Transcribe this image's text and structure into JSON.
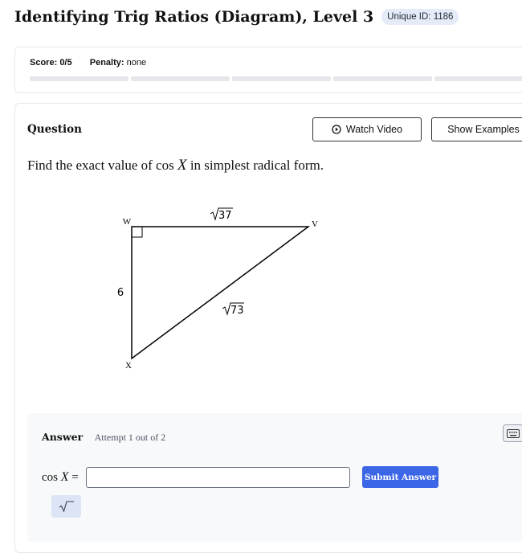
{
  "header": {
    "title": "Identifying Trig Ratios (Diagram), Level 3",
    "unique_id": "Unique ID: 1186"
  },
  "score": {
    "score_label": "Score:",
    "score_value": "0/5",
    "penalty_label": "Penalty:",
    "penalty_value": "none",
    "total_questions": 5,
    "answered": 0
  },
  "question": {
    "heading": "Question",
    "watch_video_label": "Watch Video",
    "show_examples_label": "Show Examples",
    "prompt_before": "Find the exact value of cos",
    "prompt_var": "X",
    "prompt_after": "in simplest radical form."
  },
  "diagram": {
    "vertex_w": "W",
    "vertex_v": "V",
    "vertex_x": "X",
    "side_wx": "6",
    "side_wv": "37",
    "side_xv": "73"
  },
  "answer": {
    "title": "Answer",
    "attempt": "Attempt 1 out of 2",
    "eq_fn": "cos",
    "eq_var": "X",
    "eq_sign": "=",
    "input_value": "",
    "submit_label": "Submit Answer"
  },
  "icons": {
    "play": "play-circle-icon",
    "keyboard": "keyboard-icon",
    "sqrt": "square-root-icon"
  },
  "colors": {
    "accent": "#3b66e6",
    "badge_bg": "#e5ecf7",
    "answer_bg": "#f8f9fa"
  }
}
